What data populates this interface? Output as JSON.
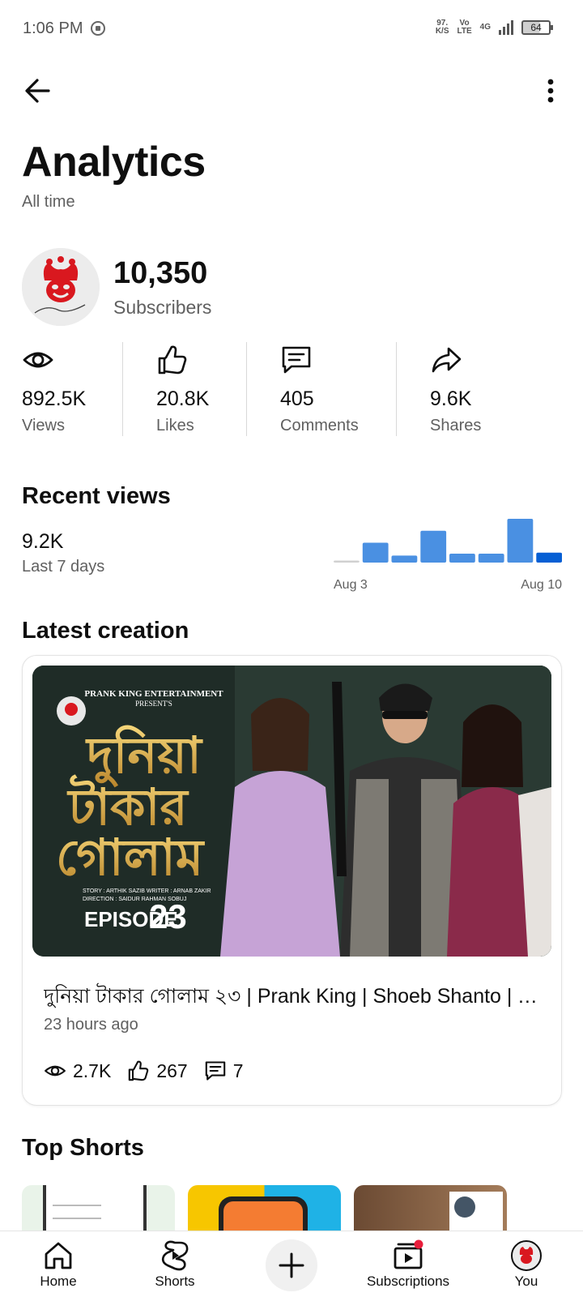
{
  "status_bar": {
    "time": "1:06 PM",
    "speed_top": "97.",
    "speed_bottom": "K/S",
    "volte_top": "Vo",
    "volte_bottom": "LTE",
    "network": "4G",
    "battery": "64"
  },
  "header": {
    "back_icon": "arrow-left-icon",
    "more_icon": "more-vertical-icon"
  },
  "page": {
    "title": "Analytics",
    "subtitle": "All time"
  },
  "channel": {
    "avatar_icon": "prank-king-logo",
    "subscribers_value": "10,350",
    "subscribers_label": "Subscribers"
  },
  "stats": [
    {
      "icon": "eye-icon",
      "value": "892.5K",
      "label": "Views"
    },
    {
      "icon": "thumbs-up-icon",
      "value": "20.8K",
      "label": "Likes"
    },
    {
      "icon": "comment-icon",
      "value": "405",
      "label": "Comments"
    },
    {
      "icon": "share-icon",
      "value": "9.6K",
      "label": "Shares"
    }
  ],
  "recent_views": {
    "title": "Recent views",
    "value": "9.2K",
    "label": "Last 7 days"
  },
  "chart_data": {
    "type": "bar",
    "title": "",
    "categories": [
      "",
      "",
      "",
      "",
      "",
      "",
      "",
      ""
    ],
    "values": [
      0.1,
      1.0,
      0.35,
      1.6,
      0.45,
      0.45,
      2.2,
      0.5
    ],
    "tick_labels": [
      "Aug 3",
      "Aug 10"
    ],
    "colors": {
      "past": "#4a90e2",
      "current": "#065fd4",
      "empty": "#d0d0d0"
    },
    "xlabel": "",
    "ylabel": ""
  },
  "latest_creation": {
    "section_title": "Latest creation",
    "video_title": "দুনিয়া টাকার গোলাম ২৩ | Prank King | Shoeb Shanto | Tasnuva Tisha | Bangla Natok",
    "posted": "23 hours ago",
    "views": "2.7K",
    "likes": "267",
    "comments": "7",
    "thumbnail": {
      "presenter": "PRANK KING ENTERTAINMENT",
      "presents": "PRESENT'S",
      "title_line1": "দুনিয়া",
      "title_line2": "টাকার",
      "title_line3": "গোলাম",
      "credits_line1": "STORY : ARTHIK SAZIB  WRITER : ARNAB ZAKIR",
      "credits_line2": "DIRECTION : SAIDUR RAHMAN SOBUJ",
      "episode_word": "EPISODE",
      "episode_number": "23"
    }
  },
  "top_shorts": {
    "title": "Top Shorts"
  },
  "bottom_nav": {
    "home": "Home",
    "shorts": "Shorts",
    "subscriptions": "Subscriptions",
    "you": "You"
  }
}
